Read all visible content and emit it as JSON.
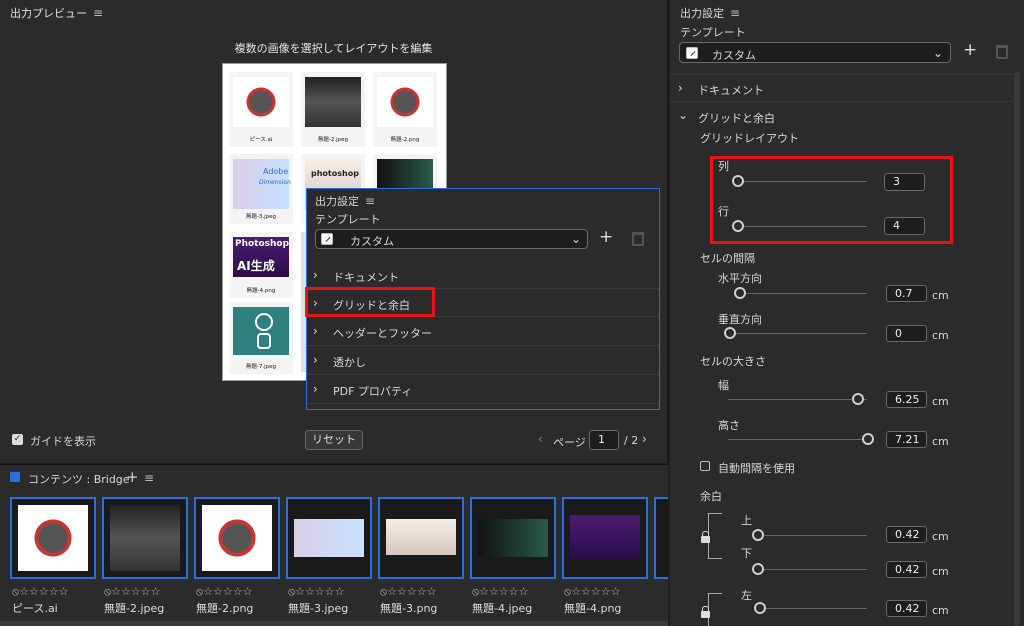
{
  "preview": {
    "title": "出力プレビュー",
    "heading": "複数の画像を選択してレイアウトを編集",
    "sheet_captions": [
      "ピース.ai",
      "無題-2.jpeg",
      "無題-2.png",
      "無題-3.jpeg",
      "",
      "",
      "無題-4.png",
      "",
      "",
      "無題-7.jpeg",
      "",
      ""
    ],
    "sheet_texts": {
      "adobe": "Adobe",
      "dimension": "Dimension",
      "photoshop_small": "photoshop",
      "photoshop_big": "Photoshop",
      "ai_gen": "AI生成"
    },
    "show_guides_label": "ガイドを表示",
    "reset_label": "リセット",
    "page_label": "ページ",
    "page_value": "1",
    "page_total": "/ 2"
  },
  "overlay": {
    "title": "出力設定",
    "template_label": "テンプレート",
    "template_value": "カスタム",
    "sections": [
      "ドキュメント",
      "グリッドと余白",
      "ヘッダーとフッター",
      "透かし",
      "PDF プロパティ"
    ]
  },
  "content": {
    "title": "コンテンツ : Bridge",
    "stars": "⦸☆☆☆☆☆",
    "thumbs": [
      "ピース.ai",
      "無題-2.jpeg",
      "無題-2.png",
      "無題-3.jpeg",
      "無題-3.png",
      "無題-4.jpeg",
      "無題-4.png"
    ]
  },
  "settings": {
    "title": "出力設定",
    "template_label": "テンプレート",
    "template_value": "カスタム",
    "document_label": "ドキュメント",
    "grid_margin_label": "グリッドと余白",
    "grid_layout_label": "グリッドレイアウト",
    "columns_label": "列",
    "columns_value": "3",
    "rows_label": "行",
    "rows_value": "4",
    "cell_spacing_label": "セルの間隔",
    "horizontal_label": "水平方向",
    "horizontal_value": "0.7",
    "vertical_label": "垂直方向",
    "vertical_value": "0",
    "cell_size_label": "セルの大きさ",
    "width_label": "幅",
    "width_value": "6.25",
    "height_label": "高さ",
    "height_value": "7.21",
    "auto_spacing_label": "自動間隔を使用",
    "margin_label": "余白",
    "top_label": "上",
    "top_value": "0.42",
    "bottom_label": "下",
    "bottom_value": "0.42",
    "left_label": "左",
    "left_value": "0.42",
    "unit": "cm",
    "accent_color": "#2a6fe0",
    "highlight_color": "#e8121b"
  }
}
